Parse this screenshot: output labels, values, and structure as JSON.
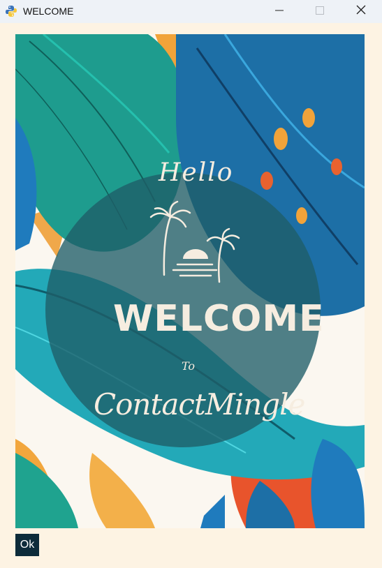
{
  "window": {
    "title": "WELCOME",
    "icon": "python-icon",
    "controls": [
      "minimize-icon",
      "maximize-icon",
      "close-icon"
    ]
  },
  "poster": {
    "greeting": "Hello",
    "headline": "WELCOME",
    "connector": "To",
    "app_name": "ContactMingle"
  },
  "buttons": {
    "ok_label": "Ok"
  },
  "colors": {
    "background": "#fdf3e3",
    "titlebar": "#eef2f7",
    "ok_button": "#0d2b3a",
    "overlay_circle": "#1f5d68"
  }
}
